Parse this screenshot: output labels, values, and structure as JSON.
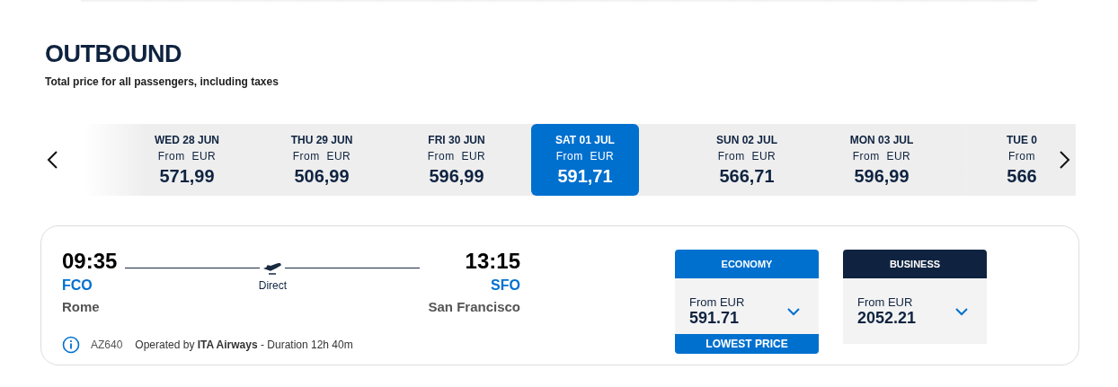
{
  "heading": "OUTBOUND",
  "subtitle": "Total price for all passengers, including taxes",
  "dates": [
    {
      "day": "WED 28 JUN",
      "from": "From  EUR",
      "price": "571,99",
      "selected": false
    },
    {
      "day": "THU 29 JUN",
      "from": "From  EUR",
      "price": "506,99",
      "selected": false
    },
    {
      "day": "FRI 30 JUN",
      "from": "From  EUR",
      "price": "596,99",
      "selected": false
    },
    {
      "day": "SAT 01 JUL",
      "from": "From  EUR",
      "price": "591,71",
      "selected": true
    },
    {
      "day": "SUN 02 JUL",
      "from": "From  EUR",
      "price": "566,71",
      "selected": false
    },
    {
      "day": "MON 03 JUL",
      "from": "From  EUR",
      "price": "596,99",
      "selected": false
    },
    {
      "day": "TUE 0",
      "from": "From",
      "price": "566",
      "selected": false
    }
  ],
  "flight": {
    "depart_time": "09:35",
    "depart_code": "FCO",
    "depart_city": "Rome",
    "stops": "Direct",
    "arrive_time": "13:15",
    "arrive_code": "SFO",
    "arrive_city": "San Francisco",
    "number": "AZ640",
    "operated": "Operated by **ITA Airways** - Duration 12h 40m"
  },
  "fares": [
    {
      "kind": "economy",
      "name": "ECONOMY",
      "from": "From EUR",
      "price": "591.71",
      "badge": "LOWEST PRICE"
    },
    {
      "kind": "business",
      "name": "BUSINESS",
      "from": "From EUR",
      "price": "2052.21"
    }
  ]
}
